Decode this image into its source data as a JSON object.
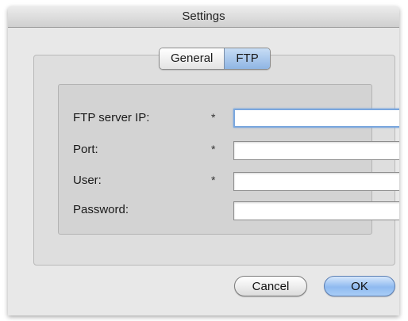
{
  "window": {
    "title": "Settings"
  },
  "tabs": [
    {
      "label": "General",
      "active": false
    },
    {
      "label": "FTP",
      "active": true
    }
  ],
  "form": {
    "fields": [
      {
        "label": "FTP server IP:",
        "required_mark": "*",
        "value": ""
      },
      {
        "label": "Port:",
        "required_mark": "*",
        "value": ""
      },
      {
        "label": "User:",
        "required_mark": "*",
        "value": ""
      },
      {
        "label": "Password:",
        "required_mark": "",
        "value": ""
      }
    ]
  },
  "buttons": {
    "cancel_label": "Cancel",
    "ok_label": "OK"
  },
  "colors": {
    "accent_blue": "#8fb5e3",
    "focus_ring": "#7aa7de"
  }
}
